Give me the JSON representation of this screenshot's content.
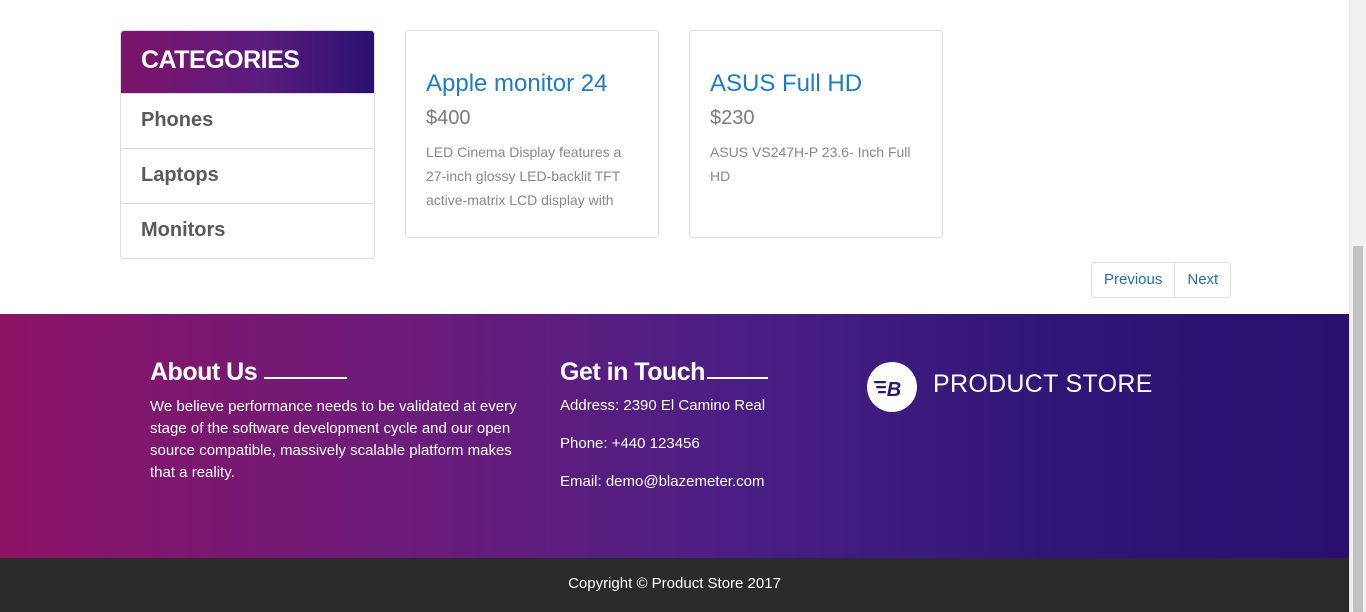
{
  "categories": {
    "title": "CATEGORIES",
    "items": [
      {
        "label": "Phones"
      },
      {
        "label": "Laptops"
      },
      {
        "label": "Monitors"
      }
    ]
  },
  "products": [
    {
      "title": "Apple monitor 24",
      "price": "$400",
      "description": "LED Cinema Display features a 27-inch glossy LED-backlit TFT active-matrix LCD display with"
    },
    {
      "title": "ASUS Full HD",
      "price": "$230",
      "description": "ASUS VS247H-P 23.6- Inch Full HD"
    }
  ],
  "pagination": {
    "previous_label": "Previous",
    "next_label": "Next"
  },
  "footer": {
    "about": {
      "title": "About Us",
      "text": "We believe performance needs to be validated at every stage of the software development cycle and our open source compatible, massively scalable platform makes that a reality."
    },
    "contact": {
      "title": "Get in Touch",
      "address": "Address: 2390 El Camino Real",
      "phone": "Phone: +440 123456",
      "email": "Email: demo@blazemeter.com"
    },
    "brand": {
      "name": "PRODUCT STORE",
      "icon": "blazemeter-logo-icon"
    },
    "copyright": "Copyright © Product Store 2017"
  },
  "colors": {
    "accent_link": "#1e7cc4",
    "footer_gradient_start": "#8b1366",
    "footer_gradient_end": "#2a0f6e",
    "copyright_bg": "#2b2b2b"
  }
}
